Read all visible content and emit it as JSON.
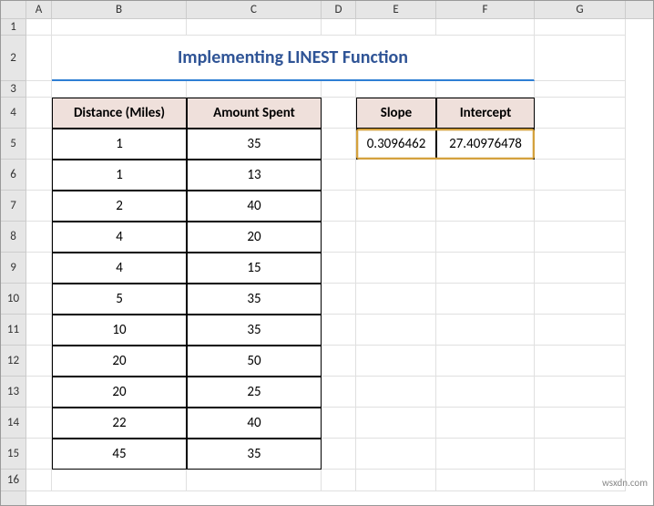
{
  "columns": [
    "A",
    "B",
    "C",
    "D",
    "E",
    "F",
    "G"
  ],
  "rows": [
    "1",
    "2",
    "3",
    "4",
    "5",
    "6",
    "7",
    "8",
    "9",
    "10",
    "11",
    "12",
    "13",
    "14",
    "15",
    "16"
  ],
  "title": "Implementing LINEST Function",
  "table1": {
    "headers": [
      "Distance (Miles)",
      "Amount Spent"
    ],
    "data": [
      [
        "1",
        "35"
      ],
      [
        "1",
        "13"
      ],
      [
        "2",
        "40"
      ],
      [
        "4",
        "20"
      ],
      [
        "4",
        "15"
      ],
      [
        "5",
        "35"
      ],
      [
        "10",
        "35"
      ],
      [
        "20",
        "50"
      ],
      [
        "20",
        "25"
      ],
      [
        "22",
        "40"
      ],
      [
        "45",
        "35"
      ]
    ]
  },
  "table2": {
    "headers": [
      "Slope",
      "Intercept"
    ],
    "data": [
      [
        "0.3096462",
        "27.40976478"
      ]
    ]
  },
  "watermark": "wsxdn.com"
}
